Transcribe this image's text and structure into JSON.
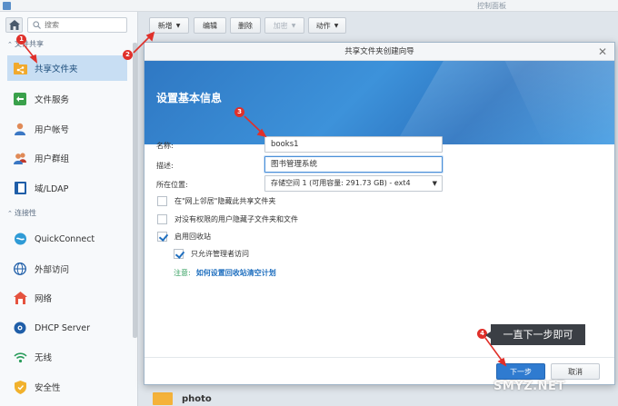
{
  "window": {
    "title": "控制面板"
  },
  "sidebar": {
    "search_placeholder": "搜索",
    "section_file_share": "文件共享",
    "section_connectivity": "连接性",
    "items": [
      {
        "label": "共享文件夹",
        "icon": "shared-folder-icon",
        "active": true
      },
      {
        "label": "文件服务",
        "icon": "file-services-icon"
      },
      {
        "label": "用户帐号",
        "icon": "user-icon"
      },
      {
        "label": "用户群组",
        "icon": "group-icon"
      },
      {
        "label": "域/LDAP",
        "icon": "domain-ldap-icon"
      },
      {
        "label": "QuickConnect",
        "icon": "quickconnect-icon"
      },
      {
        "label": "外部访问",
        "icon": "external-access-icon"
      },
      {
        "label": "网络",
        "icon": "network-icon"
      },
      {
        "label": "DHCP Server",
        "icon": "dhcp-icon"
      },
      {
        "label": "无线",
        "icon": "wireless-icon"
      },
      {
        "label": "安全性",
        "icon": "shield-icon"
      }
    ]
  },
  "toolbar": {
    "create_label": "新增",
    "edit_label": "编辑",
    "delete_label": "删除",
    "encrypt_label": "加密",
    "action_label": "动作"
  },
  "background_list": {
    "first_row": "photo"
  },
  "dialog": {
    "title": "共享文件夹创建向导",
    "heading": "设置基本信息",
    "fields": {
      "name_label": "名称:",
      "name_value": "books1",
      "desc_label": "描述:",
      "desc_value": "图书管理系统",
      "location_label": "所在位置:",
      "location_value": "存储空间 1 (可用容量:  291.73 GB) - ext4"
    },
    "options": [
      {
        "label": "在\"网上邻居\"隐藏此共享文件夹",
        "checked": false
      },
      {
        "label": "对没有权限的用户隐藏子文件夹和文件",
        "checked": false
      },
      {
        "label": "启用回收站",
        "checked": true
      },
      {
        "label": "只允许管理者访问",
        "checked": true
      }
    ],
    "note_label": "注意:",
    "note_link": "如何设置回收站清空计划",
    "next_button": "下一步",
    "cancel_button": "取消"
  },
  "annotations": {
    "markers": [
      "1",
      "2",
      "3",
      "4"
    ],
    "callout": "一直下一步即可",
    "watermark": "SMYZ.NET",
    "color": "#e0302a"
  }
}
